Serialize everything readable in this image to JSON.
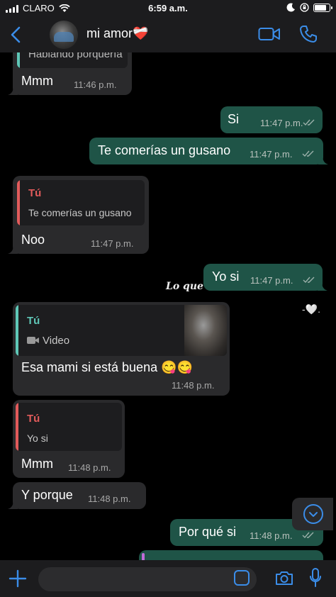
{
  "status": {
    "carrier": "CLARO",
    "time": "6:59 a.m.",
    "battery_level": 0.85
  },
  "header": {
    "contact_name": "mi amor❤️‍🩹"
  },
  "messages": [
    {
      "type": "in",
      "quote_partial": "Hablando porquería",
      "text": "Mmm",
      "time": "11:46 p.m."
    },
    {
      "type": "out",
      "text": "Si",
      "time": "11:47 p.m."
    },
    {
      "type": "out",
      "text": "Te comerías un gusano",
      "time": "11:47 p.m."
    },
    {
      "type": "in",
      "quote_author": "Tú",
      "quote_text": "Te comerías un gusano",
      "text": "Noo",
      "time": "11:47 p.m."
    },
    {
      "type": "out",
      "text": "Yo si",
      "time": "11:47 p.m."
    },
    {
      "type": "in",
      "quote_author": "Tú",
      "quote_text": "Video",
      "text": "Esa mami si está buena 😋😋",
      "time": "11:48 p.m."
    },
    {
      "type": "in",
      "quote_author": "Tú",
      "quote_text": "Yo si",
      "text": "Mmm",
      "time": "11:48 p.m."
    },
    {
      "type": "in",
      "text": "Y porque",
      "time": "11:48 p.m."
    },
    {
      "type": "out",
      "text": "Por qué si",
      "time": "11:48 p.m."
    }
  ],
  "overlay": {
    "text": "Lo que",
    "heart": "-🤍."
  },
  "colors": {
    "accent": "#3b8de8",
    "outgoing": "#1f5447",
    "incoming": "#2a2a2c",
    "quote_you": "#e25b5b",
    "quote_video": "#5fc7b7"
  }
}
